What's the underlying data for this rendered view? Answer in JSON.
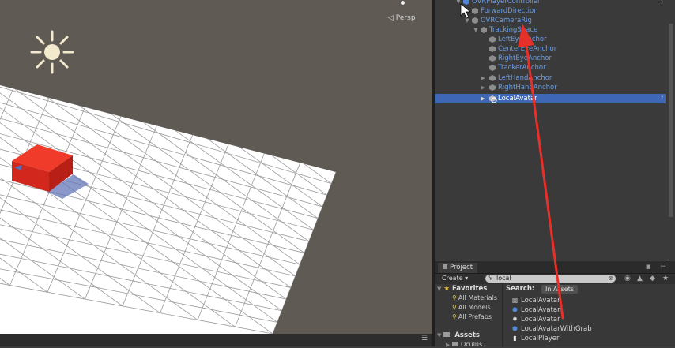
{
  "scene": {
    "view_mode_label": "◁ Persp",
    "sun_icon": "sun-icon",
    "colors": {
      "background": "#5f5a54",
      "grid": "#ffffff",
      "cube": "#e02a1f"
    }
  },
  "hierarchy": {
    "items": [
      {
        "label": "OVRPlayerController",
        "depth": 0,
        "fold": "▼",
        "icon": "cube-icon"
      },
      {
        "label": "ForwardDirection",
        "depth": 1,
        "fold": "",
        "icon": "cube-icon"
      },
      {
        "label": "OVRCameraRig",
        "depth": 1,
        "fold": "▼",
        "icon": "cube-icon"
      },
      {
        "label": "TrackingSpace",
        "depth": 2,
        "fold": "▼",
        "icon": "cube-icon"
      },
      {
        "label": "LeftEyeAnchor",
        "depth": 3,
        "fold": "",
        "icon": "cube-icon"
      },
      {
        "label": "CenterEyeAnchor",
        "depth": 3,
        "fold": "",
        "icon": "cube-icon"
      },
      {
        "label": "RightEyeAnchor",
        "depth": 3,
        "fold": "",
        "icon": "cube-icon"
      },
      {
        "label": "TrackerAnchor",
        "depth": 3,
        "fold": "",
        "icon": "cube-icon"
      },
      {
        "label": "LeftHandAnchor",
        "depth": 3,
        "fold": "▶",
        "icon": "cube-icon"
      },
      {
        "label": "RightHandAnchor",
        "depth": 3,
        "fold": "▶",
        "icon": "cube-icon"
      },
      {
        "label": "LocalAvatar",
        "depth": 3,
        "fold": "▶",
        "icon": "cube-icon",
        "selected": true
      }
    ],
    "colors": {
      "item_text": "#6b9ce4",
      "selection": "#3e68b5"
    }
  },
  "project": {
    "tab_label": "Project",
    "create_label": "Create ▾",
    "search_value": "local",
    "favorites_label": "Favorites",
    "favorites": [
      "All Materials",
      "All Models",
      "All Prefabs"
    ],
    "assets_label": "Assets",
    "assets_children": [
      "Oculus"
    ],
    "search_in_label": "Search:",
    "search_scope": "In Assets",
    "results": [
      {
        "label": "LocalAvatar",
        "icon": "folder-icon"
      },
      {
        "label": "LocalAvatar",
        "icon": "prefab-icon"
      },
      {
        "label": "LocalAvatar",
        "icon": "script-icon"
      },
      {
        "label": "LocalAvatarWithGrab",
        "icon": "prefab-icon"
      },
      {
        "label": "LocalPlayer",
        "icon": "file-icon"
      }
    ]
  },
  "annotation": {
    "arrow_color": "#e8302a"
  }
}
